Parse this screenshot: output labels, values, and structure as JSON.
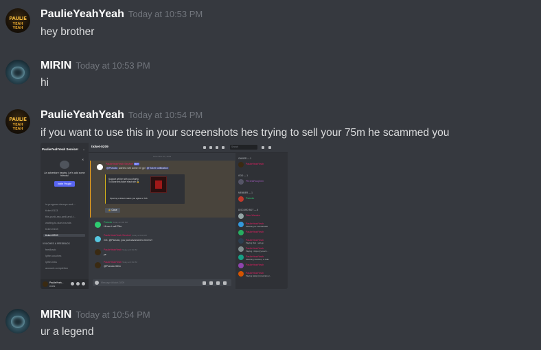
{
  "messages": [
    {
      "author": "PaulieYeahYeah",
      "timestamp": "Today at 10:53 PM",
      "text": "hey brother",
      "avatar": "paulie-avatar"
    },
    {
      "author": "MIRIN",
      "timestamp": "Today at 10:53 PM",
      "text": "hi",
      "avatar": "mirin-avatar"
    },
    {
      "author": "PaulieYeahYeah",
      "timestamp": "Today at 10:54 PM",
      "text": "if you want to use this in your screenshots hes trying to sell your 75m he scammed you",
      "avatar": "paulie-avatar"
    },
    {
      "author": "MIRIN",
      "timestamp": "Today at 10:54 PM",
      "text": "ur a legend",
      "avatar": "mirin-avatar"
    }
  ],
  "avatar_logo": {
    "line1": "PAULIE",
    "line2": "YEAH YEAH"
  },
  "attachment": {
    "server_name": "PaulieYeahYeah Service!",
    "channel": "ticket-0209",
    "search_placeholder": "Search",
    "invite": {
      "text": "An adventure begins. Let's add some friends!",
      "button": "Invite People"
    },
    "channels": [
      "in-progress-dannys-and-...",
      "ticket-0113",
      "this-punk-ass-pedi-and-t...",
      "waiting-to-start-rounds",
      "ticket-0133",
      "ticket-0209"
    ],
    "category": "VOUCHES & FEEDBACK",
    "category_channels": [
      "feedback",
      "lythe-vouches",
      "lythe-links",
      "account-completion"
    ],
    "user": {
      "name": "PaulieYeah...",
      "status": "#6469"
    },
    "date_divider": "November 22, 2023",
    "bot_message": {
      "author": "PaulieYeahYeah Service!",
      "tag": "BOT",
      "line": "want to sell some 57 gp!",
      "mention_user": "@Pseudo",
      "mention_role": "@Ticket notification",
      "card_line1": "Support will be with you shortly.",
      "card_line2": "To close this ticket react with 🔒",
      "card_footer": "Opening a ticket means you agree w ToS",
      "close_button": "🔒 Close"
    },
    "chat": [
      {
        "author": "Pseudo",
        "time": "Today at 6:08 PM",
        "text": "Hi can i sell 75m"
      },
      {
        "author": "PaulieYeahYeah Service!",
        "time": "Today at 6:08 PM",
        "text": "GG, @Pseudo, you just advanced to level 2!"
      },
      {
        "author": "PaulieYeahYeah",
        "time": "Today at 6:09 PM",
        "text": "ye"
      },
      {
        "author": "PaulieYeahYeah",
        "time": "Today at 6:09 PM",
        "text": "@Pseudo 35/m"
      }
    ],
    "input_placeholder": "Message #ticket-0209",
    "member_groups": [
      {
        "label": "OWNER — 1",
        "members": [
          {
            "name": "PaulieYeahYeah",
            "sub": "",
            "color": "#e91e63"
          }
        ]
      },
      {
        "label": "GOD — 1",
        "members": [
          {
            "name": "PhrankRuuphen",
            "sub": "",
            "color": "#9b59b6"
          }
        ]
      },
      {
        "label": "MEMBER — 1",
        "members": [
          {
            "name": "Pseudo",
            "sub": "",
            "color": "#2ecc71"
          }
        ]
      },
      {
        "label": "DISCORD BOT — 6",
        "members": [
          {
            "name": "Dino Warden",
            "sub": "",
            "color": "#e91e63"
          },
          {
            "name": "PaulieYeahYeah",
            "sub": "Watching for 1xPoll#1098",
            "color": "#e91e63"
          },
          {
            "name": "PaulieYeahYeah",
            "sub": "",
            "color": "#e91e63"
          },
          {
            "name": "PaulieYeahYeah",
            "sub": "Playing Rob - vull-gp",
            "color": "#e91e63"
          },
          {
            "name": "PaulieYeahYeah",
            "sub": "Playing - https://yyvouch...",
            "color": "#e91e63"
          },
          {
            "name": "PaulieYeahYeah",
            "sub": "Watching vouches | is.hello",
            "color": "#e91e63"
          },
          {
            "name": "PaulieYeahYeah",
            "sub": "",
            "color": "#e91e63"
          },
          {
            "name": "PaulieYeahYeah",
            "sub": "Playing [Help] | ArcusNet.io/...",
            "color": "#e91e63"
          }
        ]
      }
    ]
  },
  "colors": {
    "background": "#36393f",
    "username": "#ffffff",
    "timestamp": "#72767d",
    "text": "#dcddde"
  }
}
